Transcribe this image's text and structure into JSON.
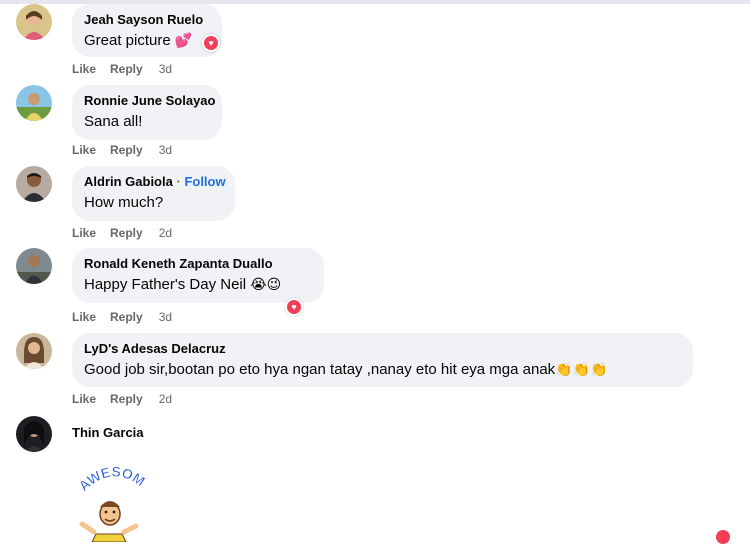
{
  "comments": [
    {
      "name": "Jeah Sayson Ruelo",
      "text": "Great picture",
      "emoji": "💕",
      "like": "Like",
      "reply": "Reply",
      "time": "3d",
      "avatar": "avatar-photo-girl"
    },
    {
      "name": "Ronnie June Solayao",
      "text": "Sana all!",
      "like": "Like",
      "reply": "Reply",
      "time": "3d",
      "avatar": "avatar-photo-outdoor"
    },
    {
      "name": "Aldrin Gabiola",
      "sep": "·",
      "follow": "Follow",
      "text": "How much?",
      "like": "Like",
      "reply": "Reply",
      "time": "2d",
      "avatar": "avatar-photo-man"
    },
    {
      "name": "Ronald Keneth Zapanta Duallo",
      "text": "Happy Father's Day Neil",
      "emoji": "😭😉",
      "like": "Like",
      "reply": "Reply",
      "time": "3d",
      "avatar": "avatar-photo-street"
    },
    {
      "name": "LyD's Adesas Delacruz",
      "text": "Good job sir,bootan po eto hya ngan tatay ,nanay eto hit eya mga anak",
      "emoji": "👏👏👏",
      "like": "Like",
      "reply": "Reply",
      "time": "2d",
      "avatar": "avatar-photo-woman"
    },
    {
      "name": "Thin Garcia",
      "sticker": "AWESOME",
      "avatar": "avatar-photo-dark"
    }
  ],
  "colors": {
    "bubble": "#f0f2f5",
    "link": "#216fdb",
    "meta": "#65676b",
    "heart": "#f33e58"
  }
}
